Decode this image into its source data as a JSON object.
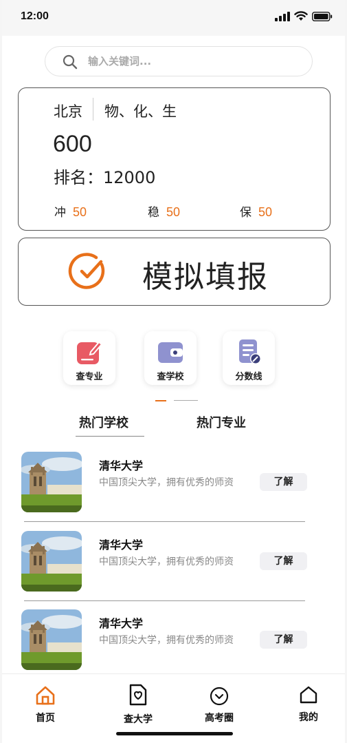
{
  "status": {
    "time": "12:00"
  },
  "search": {
    "placeholder": "输入关键词..."
  },
  "score_card": {
    "location": "北京",
    "subjects": "物、化、生",
    "score": "600",
    "rank": "排名：12000",
    "tiers": [
      {
        "label": "冲",
        "value": "50"
      },
      {
        "label": "稳",
        "value": "50"
      },
      {
        "label": "保",
        "value": "50"
      }
    ]
  },
  "simulate": {
    "label": "模拟填报"
  },
  "quick_actions": [
    {
      "label": "查专业",
      "icon": "edit-icon",
      "color": "#e85a64"
    },
    {
      "label": "查学校",
      "icon": "wallet-icon",
      "color": "#8f92cf"
    },
    {
      "label": "分数线",
      "icon": "document-edit-icon",
      "color": "#8f92cf"
    }
  ],
  "tabs": [
    {
      "label": "热门学校",
      "active": true
    },
    {
      "label": "热门专业",
      "active": false
    }
  ],
  "schools": [
    {
      "name": "清华大学",
      "desc": "中国顶尖大学，拥有优秀的师资",
      "button": "了解"
    },
    {
      "name": "清华大学",
      "desc": "中国顶尖大学，拥有优秀的师资",
      "button": "了解"
    },
    {
      "name": "清华大学",
      "desc": "中国顶尖大学，拥有优秀的师资",
      "button": "了解"
    }
  ],
  "nav": [
    {
      "label": "首页",
      "icon": "home-icon",
      "active": true
    },
    {
      "label": "查大学",
      "icon": "school-search-icon",
      "active": false
    },
    {
      "label": "高考圈",
      "icon": "circle-chevron-icon",
      "active": false
    },
    {
      "label": "我的",
      "icon": "profile-home-icon",
      "active": false
    }
  ],
  "colors": {
    "accent": "#e8701a",
    "red_icon": "#e85a64",
    "purple_icon": "#8f92cf"
  }
}
